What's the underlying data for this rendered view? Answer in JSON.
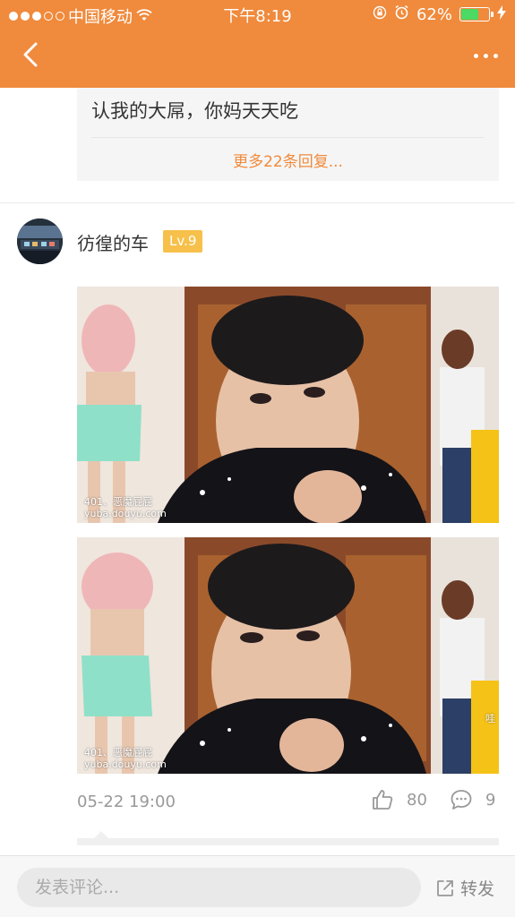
{
  "status_bar": {
    "carrier": "中国移动",
    "time": "下午8:19",
    "battery_percent": "62%",
    "battery_level": 0.62,
    "signal_bars_filled": 3,
    "signal_bars_total": 5
  },
  "nav": {
    "back_icon": "chevron-left-icon",
    "more_icon": "more-dots-icon"
  },
  "reply_preview": {
    "text": "认我的大屌，你妈天天吃",
    "more_replies_label": "更多22条回复..."
  },
  "post": {
    "author": "彷徨的车",
    "level": "Lv.9",
    "images": [
      {
        "watermark_line1": "401、恶魔屁屁",
        "watermark_line2": "yuba.douyu.com"
      },
      {
        "watermark_line1": "401、恶魔屁屁",
        "watermark_line2": "yuba.douyu.com",
        "corner_text": "哇"
      }
    ],
    "time": "05-22 19:00",
    "like_count": "80",
    "comment_count": "9"
  },
  "bottom_bar": {
    "comment_placeholder": "发表评论...",
    "share_label": "转发"
  },
  "colors": {
    "accent": "#f08a3c",
    "level_badge": "#f6c04a",
    "battery_fill": "#4cd964"
  }
}
